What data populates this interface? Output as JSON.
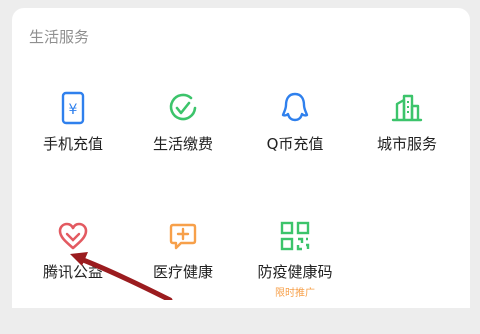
{
  "section": {
    "title": "生活服务"
  },
  "rows": [
    [
      {
        "label": "手机充值",
        "icon": "mobile-topup-icon"
      },
      {
        "label": "生活缴费",
        "icon": "bill-payment-icon"
      },
      {
        "label": "Q币充值",
        "icon": "qq-penguin-icon"
      },
      {
        "label": "城市服务",
        "icon": "city-buildings-icon"
      }
    ],
    [
      {
        "label": "腾讯公益",
        "icon": "charity-heart-icon"
      },
      {
        "label": "医疗健康",
        "icon": "medical-plus-icon"
      },
      {
        "label": "防疫健康码",
        "icon": "qr-code-icon",
        "sub": "限时推广"
      }
    ]
  ],
  "colors": {
    "blue": "#2f80ed",
    "green": "#3cc46b",
    "red": "#e35a61",
    "orange": "#f7a04a",
    "arrow": "#9b1c1f"
  }
}
